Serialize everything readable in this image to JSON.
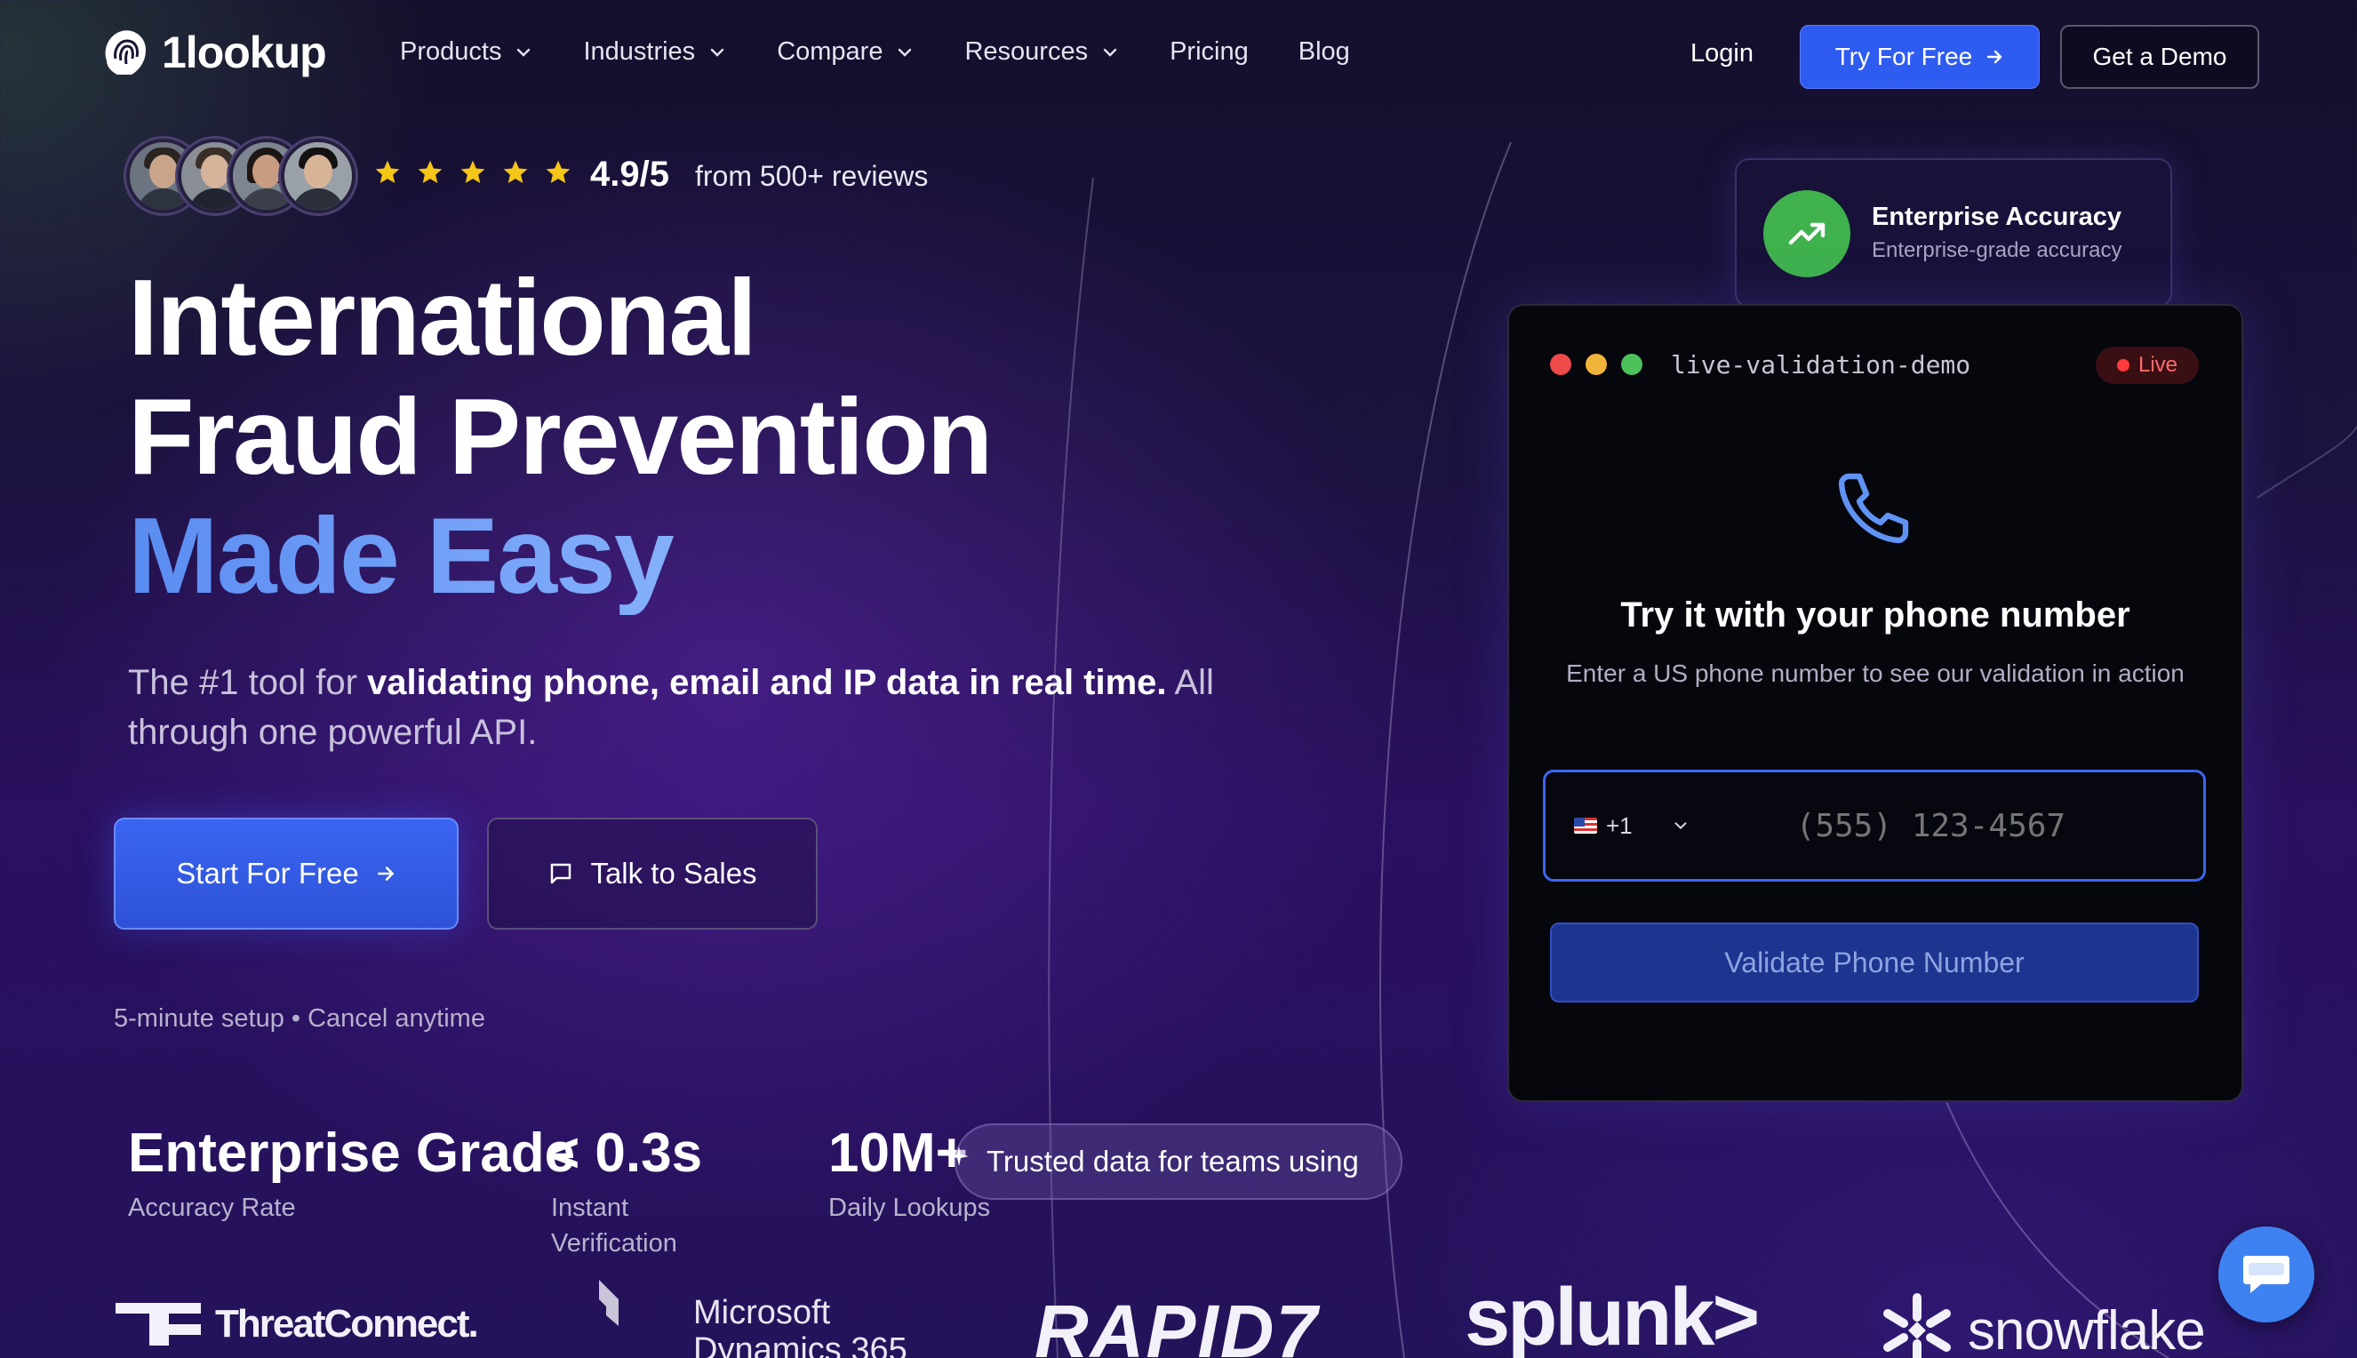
{
  "nav": {
    "brand": "1lookup",
    "menu": [
      {
        "label": "Products",
        "dropdown": true
      },
      {
        "label": "Industries",
        "dropdown": true
      },
      {
        "label": "Compare",
        "dropdown": true
      },
      {
        "label": "Resources",
        "dropdown": true
      },
      {
        "label": "Pricing",
        "dropdown": false
      },
      {
        "label": "Blog",
        "dropdown": false
      }
    ],
    "login": "Login",
    "try_free": "Try For Free",
    "demo": "Get a Demo"
  },
  "reviews": {
    "rating": "4.9/5",
    "text": "from 500+ reviews",
    "stars": 5,
    "star_color": "#f5c518"
  },
  "hero": {
    "line1": "International",
    "line2": "Fraud Prevention",
    "line3": "Made Easy",
    "sub_prefix": "The #1 tool for ",
    "sub_bold": "validating phone, email and IP data in real time.",
    "sub_suffix": " All through one powerful API."
  },
  "cta": {
    "start": "Start For Free",
    "sales": "Talk to Sales",
    "note": "5-minute setup • Cancel anytime"
  },
  "stats": [
    {
      "value": "Enterprise Grade",
      "label": "Accuracy Rate"
    },
    {
      "value": "< 0.3s",
      "label": "Instant Verification"
    },
    {
      "value": "10M+",
      "label": "Daily Lookups"
    }
  ],
  "trusted": "Trusted data for teams using",
  "logos": {
    "threatconnect": "ThreatConnect.",
    "microsoft_l1": "Microsoft",
    "microsoft_l2": "Dynamics 365",
    "rapid7": "RAPID7",
    "splunk": "splunk>",
    "snowflake": "snowflake"
  },
  "accuracy_card": {
    "title": "Enterprise Accuracy",
    "subtitle": "Enterprise-grade accuracy"
  },
  "demo": {
    "window_title": "live-validation-demo",
    "live": "Live",
    "heading": "Try it with your phone number",
    "description": "Enter a US phone number to see our validation in action",
    "country_code": "+1",
    "placeholder": "(555) 123-4567",
    "button": "Validate Phone Number"
  },
  "colors": {
    "accent": "#2f5cf0",
    "green": "#3fb24e",
    "live_red": "#ff3b3b"
  }
}
